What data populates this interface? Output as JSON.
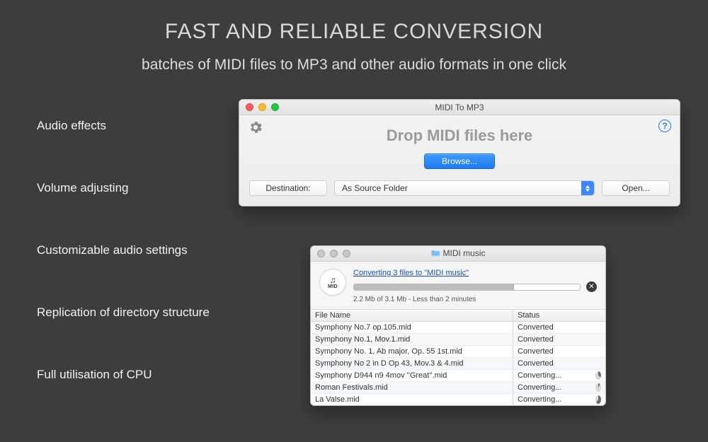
{
  "heading": "FAST AND RELIABLE CONVERSION",
  "subheading": "batches of MIDI files to MP3 and other audio formats in one click",
  "features": [
    "Audio effects",
    "Volume adjusting",
    "Customizable audio settings",
    "Replication of directory structure",
    "Full utilisation of CPU"
  ],
  "main_window": {
    "title": "MIDI To MP3",
    "drop_label": "Drop MIDI files here",
    "browse_label": "Browse...",
    "destination_label": "Destination:",
    "destination_value": "As Source Folder",
    "open_label": "Open...",
    "help_char": "?"
  },
  "progress_window": {
    "title": "MIDI music",
    "badge_text": "MID",
    "link_text": "Converting 3 files to \"MIDI music\"",
    "progress_pct": 71,
    "eta_text": "2.2 Mb of 3.1 Mb - Less than 2 minutes",
    "col_filename": "File Name",
    "col_status": "Status",
    "rows": [
      {
        "name": "Symphony No.7 op.105.mid",
        "status": "Converted",
        "pie": null
      },
      {
        "name": "Symphony No.1, Mov.1.mid",
        "status": "Converted",
        "pie": null
      },
      {
        "name": "Symphony No. 1, Ab major, Op. 55 1st.mid",
        "status": "Converted",
        "pie": null
      },
      {
        "name": "Symphony No 2 in D Op 43, Mov.3 & 4.mid",
        "status": "Converted",
        "pie": null
      },
      {
        "name": "Symphony D944 n9 4mov ''Great''.mid",
        "status": "Converting...",
        "pie": 35
      },
      {
        "name": "Roman Festivals.mid",
        "status": "Converting...",
        "pie": 8
      },
      {
        "name": "La Valse.mid",
        "status": "Converting...",
        "pie": 60
      }
    ]
  }
}
